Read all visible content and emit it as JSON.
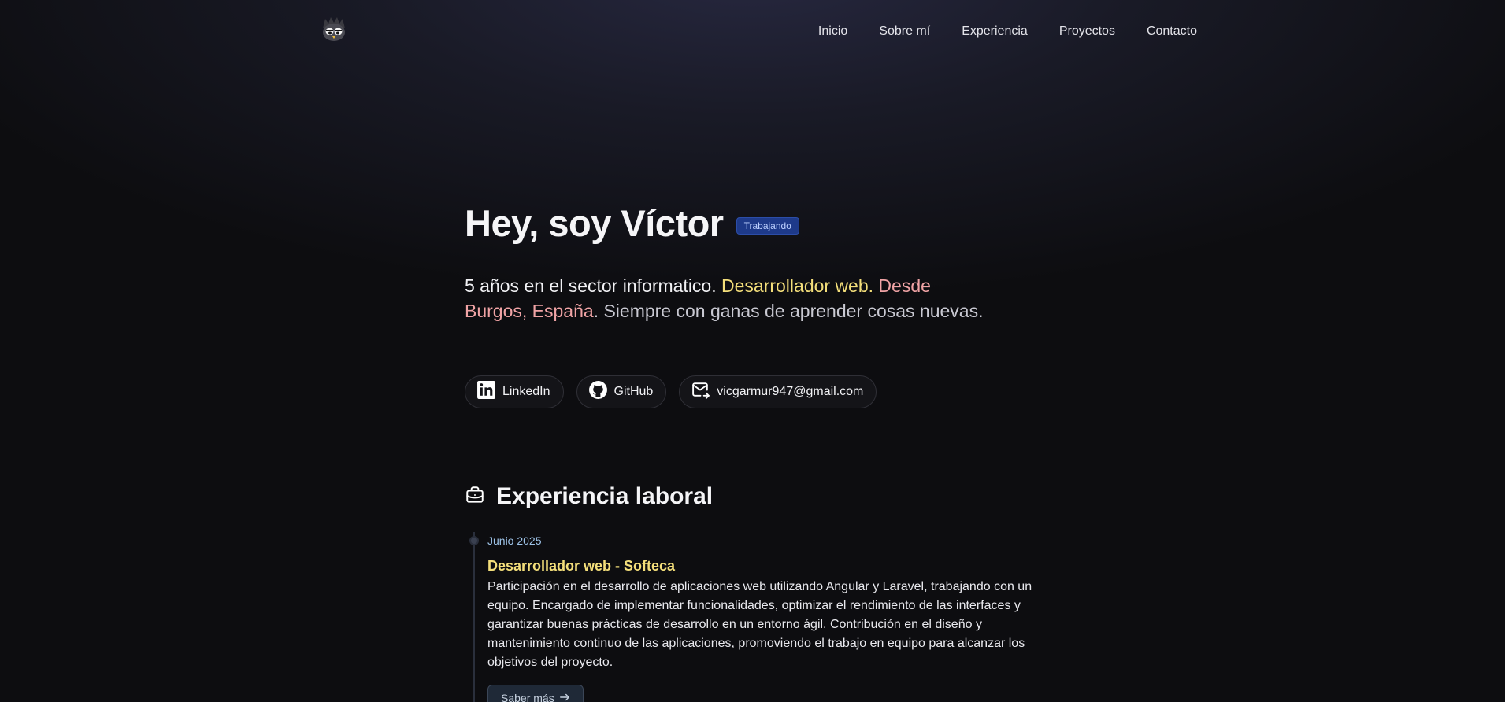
{
  "nav": {
    "items": [
      "Inicio",
      "Sobre mí",
      "Experiencia",
      "Proyectos",
      "Contacto"
    ]
  },
  "hero": {
    "title": "Hey, soy Víctor",
    "badge": "Trabajando",
    "text_part1": "5 años en el sector informatico.",
    "text_part2": "Desarrollador web.",
    "text_part3": "Desde Burgos, España",
    "text_part4": ". Siempre con ganas de aprender cosas nuevas."
  },
  "links": {
    "linkedin": "LinkedIn",
    "github": "GitHub",
    "email": "vicgarmur947@gmail.com"
  },
  "experience": {
    "title": "Experiencia laboral",
    "items": [
      {
        "date": "Junio 2025",
        "role": "Desarrollador web - Softeca",
        "description": "Participación en el desarrollo de aplicaciones web utilizando Angular y Laravel, trabajando con un equipo. Encargado de implementar funcionalidades, optimizar el rendimiento de las interfaces y garantizar buenas prácticas de desarrollo en un entorno ágil. Contribución en el diseño y mantenimiento continuo de las aplicaciones, promoviendo el trabajo en equipo para alcanzar los objetivos del proyecto.",
        "button": "Saber más"
      }
    ]
  },
  "colors": {
    "accent_yellow": "#f3de7a",
    "accent_pink": "#f0a3a5",
    "badge_bg": "#1e3a8a",
    "date_blue": "#9ec3e8"
  }
}
